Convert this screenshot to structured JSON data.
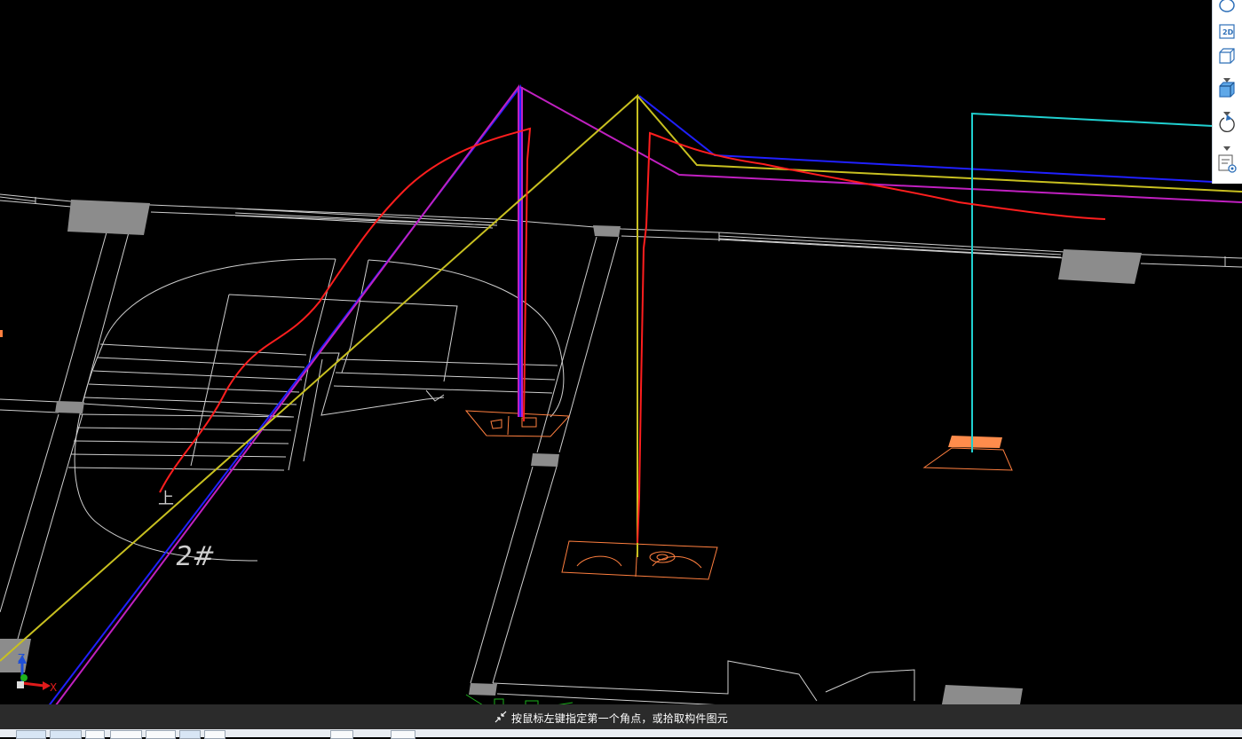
{
  "status": {
    "prompt_text": "按鼠标左键指定第一个角点，或拾取构件图元"
  },
  "drawing": {
    "text_labels": {
      "room_no": "2#",
      "up_mark": "上"
    }
  },
  "axes": {
    "z_label": "Z",
    "x_label": "X",
    "z_color": "#1e4fd8",
    "x_color": "#e01b1b",
    "y_color": "#1db31d"
  },
  "right_toolbar": {
    "buttons": [
      "orbit-icon",
      "view-2d-icon",
      "cube-wireframe-icon",
      "cube-solid-icon",
      "rotate-icon",
      "display-settings-icon"
    ],
    "view_2d_label": "2D"
  },
  "colors": {
    "background": "#000000",
    "wall_lines": "#cfcfcf",
    "column": "#8c8c8c",
    "fixture": "#ff7f3f",
    "pipe_red": "#ff1e1e",
    "pipe_blue": "#2020ff",
    "pipe_magenta": "#c020c0",
    "pipe_yellow": "#c8c020",
    "pipe_cyan": "#20d0d0",
    "status_bar": "#2b2b2b"
  }
}
